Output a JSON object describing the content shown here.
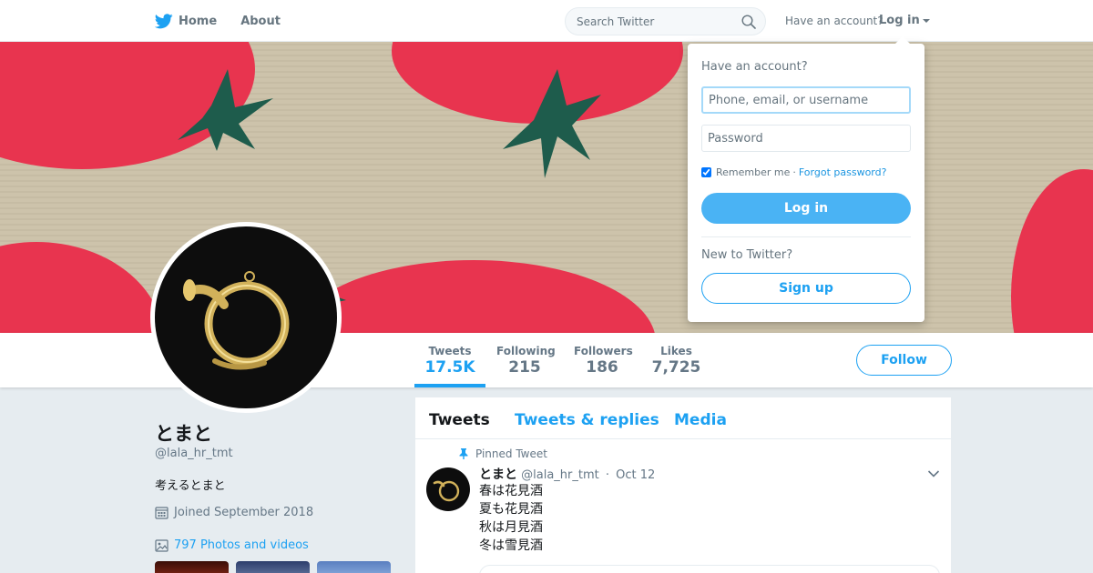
{
  "nav": {
    "home_label": "Home",
    "about_label": "About",
    "search_placeholder": "Search Twitter",
    "have_account": "Have an account?",
    "login_label": "Log in",
    "brand_color": "#1da1f2"
  },
  "profile": {
    "display_name": "とまと",
    "screen_name": "@lala_hr_tmt",
    "bio": "考えるとまと",
    "joined": "Joined September 2018",
    "photos_label": "797 Photos and videos",
    "follow_label": "Follow"
  },
  "stats": [
    {
      "label": "Tweets",
      "value": "17.5K"
    },
    {
      "label": "Following",
      "value": "215"
    },
    {
      "label": "Followers",
      "value": "186"
    },
    {
      "label": "Likes",
      "value": "7,725"
    }
  ],
  "timeline": {
    "tabs": [
      "Tweets",
      "Tweets & replies",
      "Media"
    ],
    "pinned_label": "Pinned Tweet",
    "tweet": {
      "name": "とまと",
      "handle": "@lala_hr_tmt",
      "separator": "·",
      "date": "Oct 12",
      "lines": [
        "春は花見酒",
        "夏も花見酒",
        "秋は月見酒",
        "冬は雪見酒"
      ]
    }
  },
  "login_dropdown": {
    "title": "Have an account?",
    "username_placeholder": "Phone, email, or username",
    "password_placeholder": "Password",
    "remember_label": "Remember me",
    "separator": "·",
    "forgot_label": "Forgot password?",
    "login_button": "Log in",
    "new_to": "New to Twitter?",
    "signup_button": "Sign up"
  }
}
